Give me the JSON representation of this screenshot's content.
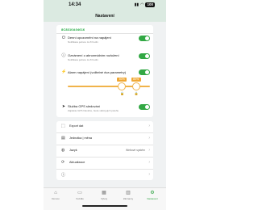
{
  "status_bar": {
    "time": "14:34",
    "battery": "100"
  },
  "header": {
    "title": "Nastavení"
  },
  "device": {
    "id": "8C8310A04616"
  },
  "settings": [
    {
      "title": "Denní upozornění na napájení",
      "subtitle": "Notifikace jednou za 8 hodin"
    },
    {
      "title": "Oznámení o abnormálním rozložení",
      "subtitle": "Notifikace jednou za 8 hodin"
    },
    {
      "title": "Alarm napájení (volitelné dva parametry)"
    },
    {
      "title": "Služba GPS sledování",
      "subtitle": "Zajistěte GPS hlavičce, bude vidět jejich polohu"
    }
  ],
  "slider": {
    "low_label": "80%",
    "high_label": "80%",
    "low_value": 0.66,
    "high_value": 0.83,
    "accent": "#f0a834"
  },
  "menu": [
    {
      "label": "Export dat",
      "value": "",
      "icon": "export-icon"
    },
    {
      "label": "Jednotka | měna",
      "value": "",
      "icon": "ruler-icon"
    },
    {
      "label": "Jazyk",
      "value": "Webové systém",
      "icon": "globe-icon"
    },
    {
      "label": "Aktualizace",
      "value": "",
      "icon": "update-icon"
    },
    {
      "label": "",
      "value": "",
      "icon": "info-icon"
    }
  ],
  "tabs": [
    {
      "label": "Domov",
      "icon": "home-icon",
      "active": false
    },
    {
      "label": "Vozidlo",
      "icon": "car-icon",
      "active": false
    },
    {
      "label": "Výlety",
      "icon": "trips-icon",
      "active": false
    },
    {
      "label": "Záznamy",
      "icon": "records-icon",
      "active": false
    },
    {
      "label": "Nastavení",
      "icon": "settings-icon",
      "active": true
    }
  ],
  "colors": {
    "accent_green": "#32a844",
    "accent_orange": "#f0a834",
    "header_bg": "#dbeae1"
  }
}
